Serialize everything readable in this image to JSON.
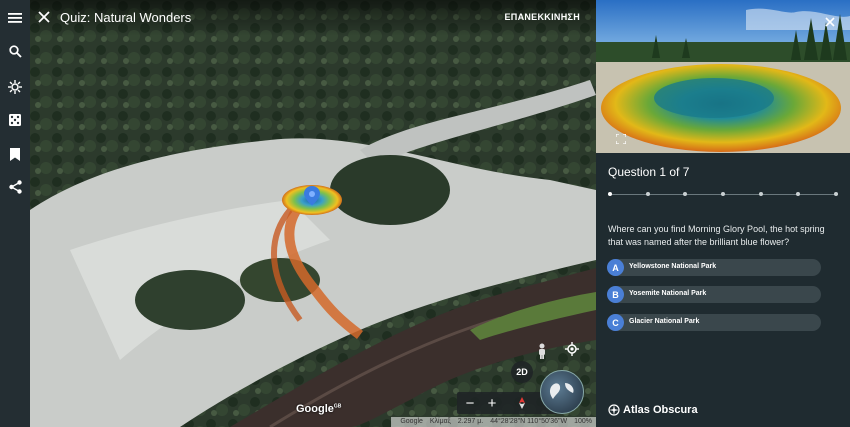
{
  "map": {
    "title": "Quiz: Natural Wonders",
    "restart_label": "ΕΠΑΝΕΚΚΙΝΗΣΗ",
    "view_toggle_label": "2D",
    "zoom_out_label": "−",
    "zoom_in_label": "+",
    "google_label": "Google",
    "google_sup": "GB",
    "attribution": [
      "Google",
      "Κλίμαξ",
      "2.297 μ.",
      "44°28'28\"N 110°50'36\"W",
      "100%"
    ]
  },
  "rail_icons": [
    "menu-icon",
    "search-icon",
    "voyager-icon",
    "dice-icon",
    "bookmark-icon",
    "share-icon"
  ],
  "quiz": {
    "question_counter": "Question 1 of 7",
    "progress": {
      "current": 1,
      "total": 7
    },
    "question": "Where can you find Morning Glory Pool, the hot spring that was named after the brilliant blue flower?",
    "answers": [
      {
        "letter": "A",
        "text": "Yellowstone National Park"
      },
      {
        "letter": "B",
        "text": "Yosemite National Park"
      },
      {
        "letter": "C",
        "text": "Glacier National Park"
      }
    ],
    "brand": "Atlas Obscura"
  },
  "colors": {
    "accent_blue": "#4a7fd6",
    "panel_bg": "#1f2b30",
    "rail_bg": "#242e33"
  }
}
